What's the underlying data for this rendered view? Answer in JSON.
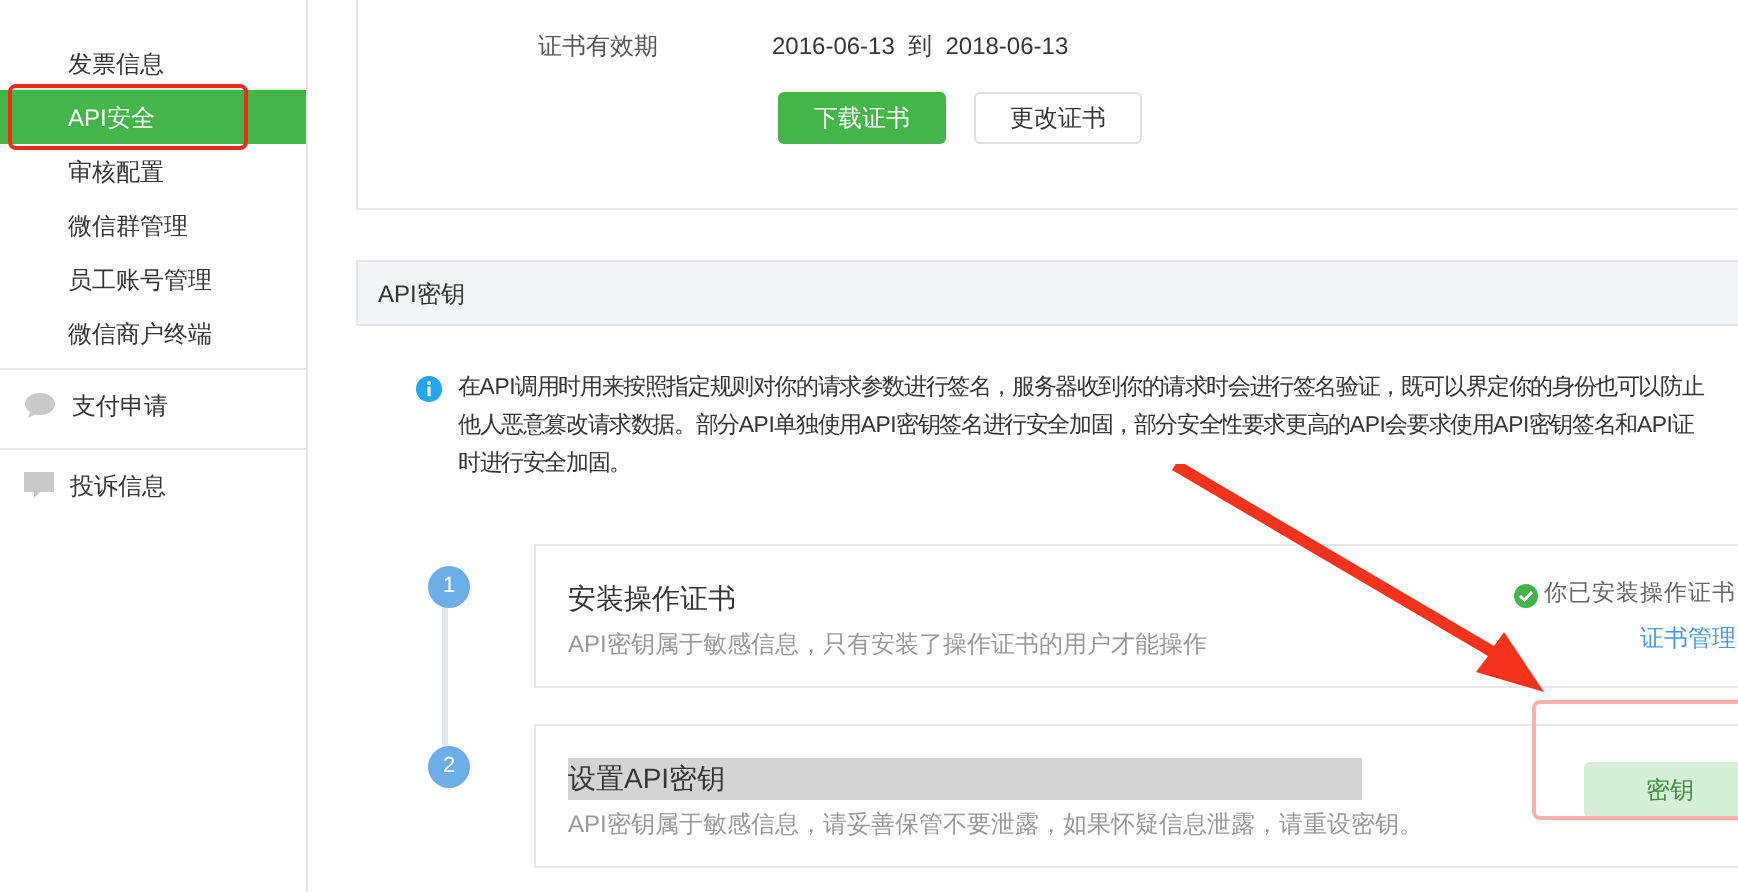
{
  "sidebar": {
    "items": [
      {
        "label": "发票信息",
        "selected": false
      },
      {
        "label": "API安全",
        "selected": true
      },
      {
        "label": "审核配置",
        "selected": false
      },
      {
        "label": "微信群管理",
        "selected": false
      },
      {
        "label": "员工账号管理",
        "selected": false
      },
      {
        "label": "微信商户终端",
        "selected": false
      }
    ],
    "sections": [
      {
        "label": "支付申请",
        "kind": "bubble"
      },
      {
        "label": "投诉信息",
        "kind": "message"
      }
    ]
  },
  "certificate": {
    "label": "证书有效期",
    "start": "2016-06-13",
    "to": "到",
    "end": "2018-06-13",
    "buttons": [
      {
        "label": "下载证书",
        "kind": "primary"
      },
      {
        "label": "更改证书",
        "kind": "default"
      }
    ]
  },
  "api_key": {
    "title": "API密钥",
    "notice_lines": [
      "在API调用时用来按照指定规则对你的请求参数进行签名，服务器收到你的请求时会进行签名验证，既可以界定你的身份也可以防止",
      "他人恶意篡改请求数据。部分API单独使用API密钥签名进行安全加固，部分安全性要求更高的API会要求使用API密钥签名和API证",
      "时进行安全加固。"
    ],
    "steps": [
      {
        "number": "1",
        "title": "安装操作证书",
        "description": "API密钥属于敏感信息，只有安装了操作证书的用户才能操作",
        "highlighted": false,
        "status": "你已安装操作证书",
        "link": "证书管理"
      },
      {
        "number": "2",
        "title": "设置API密钥",
        "description": "API密钥属于敏感信息，请妥善保管不要泄露，如果怀疑信息泄露，请重设密钥。",
        "highlighted": true,
        "button": "密钥"
      }
    ]
  }
}
